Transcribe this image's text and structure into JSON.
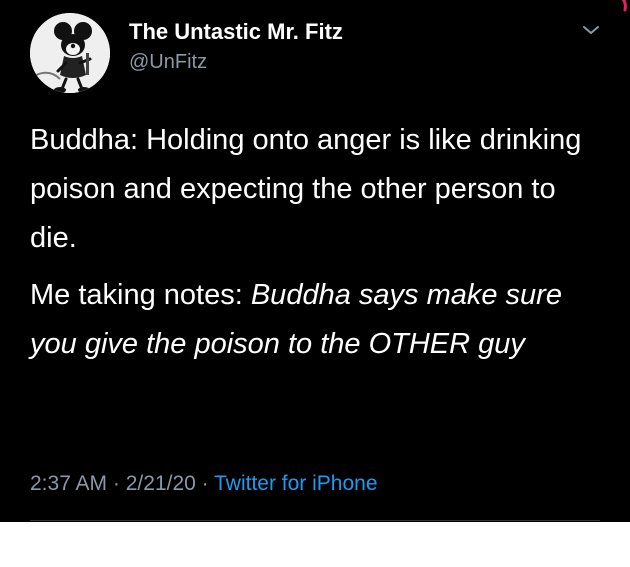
{
  "tweet": {
    "display_name": "The Untastic Mr. Fitz",
    "handle": "@UnFitz",
    "paragraph1": "Buddha: Holding onto anger is like drinking poison and expecting the other person to die.",
    "paragraph2_prefix": "Me taking notes: ",
    "paragraph2_italic": "Buddha says make sure you give the poison to the OTHER guy",
    "time": "2:37 AM",
    "separator": " · ",
    "date": "2/21/20",
    "source": "Twitter for iPhone"
  },
  "icons": {
    "avatar": "cartoon-mouse-avatar",
    "menu": "chevron-down-icon"
  },
  "colors": {
    "background": "#000000",
    "text": "#ffffff",
    "secondary_text": "#8b98a5",
    "link": "#1d9bf0"
  }
}
